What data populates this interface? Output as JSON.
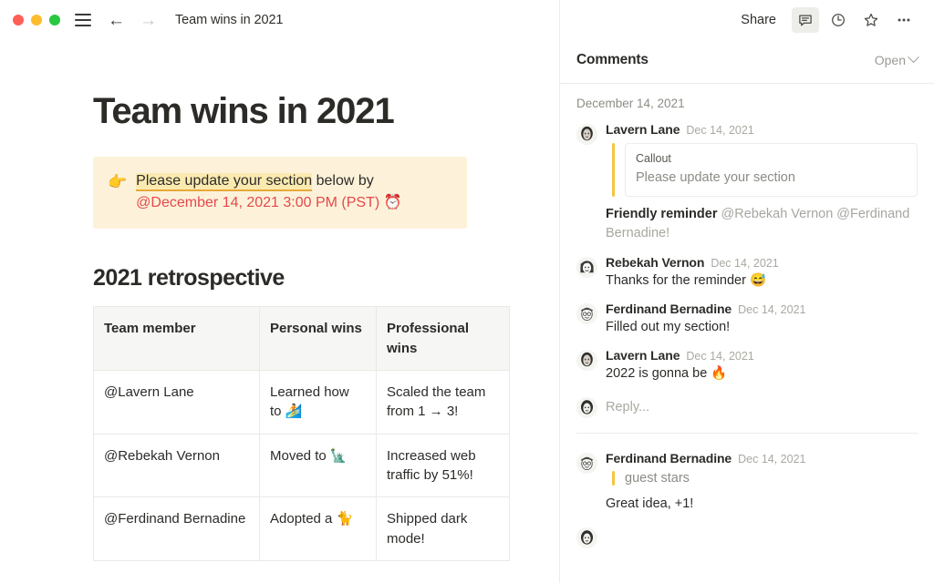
{
  "window": {
    "traffic_lights": [
      "close",
      "minimize",
      "maximize"
    ],
    "breadcrumb": "Team wins in 2021",
    "back_arrow": "←",
    "forward_arrow": "→"
  },
  "document": {
    "title": "Team wins in 2021",
    "callout": {
      "emoji": "👉",
      "highlighted": "Please update your section",
      "after_highlight": " below by ",
      "date_mention": "@December 14, 2021 3:00 PM (PST)",
      "trailing_emoji": "⏰"
    },
    "section_title": "2021 retrospective",
    "table": {
      "headers": [
        "Team member",
        "Personal wins",
        "Professional wins"
      ],
      "rows": [
        {
          "member": "@Lavern Lane",
          "personal": "Learned how to 🏄",
          "professional": "Scaled the team from 1 → 3!"
        },
        {
          "member": "@Rebekah Vernon",
          "personal": "Moved to 🗽",
          "professional": "Increased web traffic by 51%!"
        },
        {
          "member": "@Ferdinand Bernadine",
          "personal": "Adopted a 🐈",
          "professional": "Shipped dark mode!"
        }
      ]
    }
  },
  "comments_panel": {
    "toolbar": {
      "share_label": "Share",
      "comment_icon": "comment-bubble-icon",
      "history_icon": "clock-icon",
      "favorite_icon": "star-icon",
      "more_icon": "ellipsis-icon"
    },
    "header": {
      "title": "Comments",
      "filter_label": "Open"
    },
    "date_separator": "December 14, 2021",
    "threads": [
      {
        "comments": [
          {
            "author": "Lavern Lane",
            "time": "Dec 14, 2021",
            "quote": {
              "label": "Callout",
              "text": "Please update your section",
              "boxed": true
            },
            "text_bold": "Friendly reminder ",
            "text_mentions": "@Rebekah Vernon @Ferdinand Bernadine!"
          },
          {
            "author": "Rebekah Vernon",
            "time": "Dec 14, 2021",
            "text": "Thanks for the reminder 😅"
          },
          {
            "author": "Ferdinand Bernadine",
            "time": "Dec 14, 2021",
            "text": "Filled out my section!"
          },
          {
            "author": "Lavern Lane",
            "time": "Dec 14, 2021",
            "text": "2022 is gonna be 🔥"
          }
        ],
        "reply_placeholder": "Reply..."
      },
      {
        "comments": [
          {
            "author": "Ferdinand Bernadine",
            "time": "Dec 14, 2021",
            "quote": {
              "text": "guest stars",
              "boxed": false
            },
            "text": "Great idea, +1!"
          }
        ]
      }
    ]
  },
  "colors": {
    "callout_bg": "#fdf2d9",
    "highlight_bg": "#fbeab0",
    "highlight_underline": "#e8a93a",
    "date_red": "#e5484d",
    "quote_bar_yellow": "#f5c542",
    "table_header_bg": "#f6f6f4",
    "border": "#ececea",
    "traffic_red": "#ff5f57",
    "traffic_yellow": "#febc2e",
    "traffic_green": "#28c840"
  }
}
